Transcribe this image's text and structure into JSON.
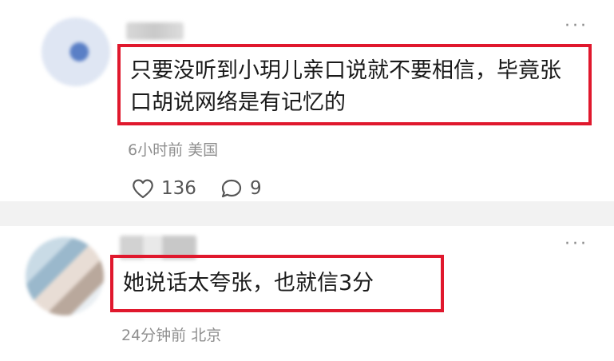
{
  "comments": [
    {
      "text": "只要没听到小玥儿亲口说就不要相信，毕竟张口胡说网络是有记忆的",
      "meta": "6小时前  美国",
      "likes": "136",
      "replies": "9",
      "more": "···"
    },
    {
      "text": "她说话太夸张，也就信3分",
      "meta": "24分钟前  北京",
      "more": "···"
    }
  ],
  "colors": {
    "highlight_border": "#e0182d",
    "meta_text": "#8f8f8f",
    "background": "#f2f2f2"
  },
  "icons": [
    "more-icon",
    "heart-icon",
    "comment-bubble-icon"
  ]
}
